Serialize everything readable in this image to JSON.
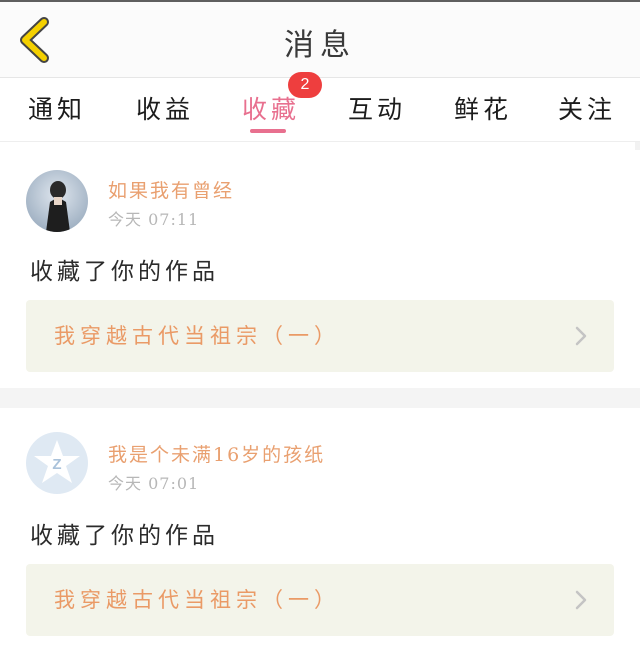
{
  "header": {
    "title": "消息"
  },
  "tabs": [
    {
      "label": "通知"
    },
    {
      "label": "收益"
    },
    {
      "label": "收藏"
    },
    {
      "label": "互动"
    },
    {
      "label": "鲜花"
    },
    {
      "label": "关注"
    }
  ],
  "active_tab": "收藏",
  "badge": {
    "count": "2"
  },
  "colors": {
    "accent": "#e8708f",
    "badge": "#ee3e3e",
    "username": "#e9a070",
    "back_icon": "#f4d000"
  },
  "items": [
    {
      "username": "如果我有曾经",
      "time": "今天 07:11",
      "action": "收藏了你的作品",
      "work_title": "我穿越古代当祖宗（一）",
      "avatar_icon": "photo-avatar"
    },
    {
      "username": "我是个未满16岁的孩纸",
      "time": "今天 07:01",
      "action": "收藏了你的作品",
      "work_title": "我穿越古代当祖宗（一）",
      "avatar_icon": "default-z-avatar"
    }
  ]
}
